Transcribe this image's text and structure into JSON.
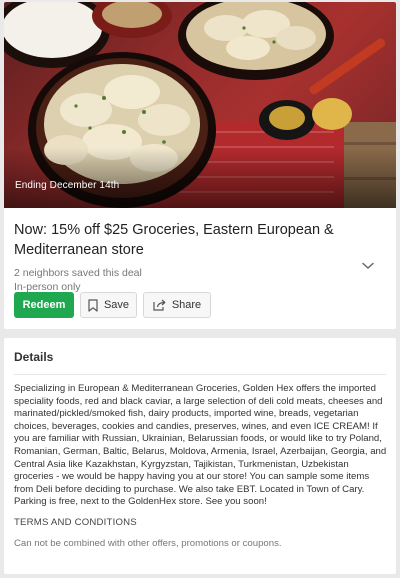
{
  "deal": {
    "ending_badge": "Ending December 14th",
    "title": "Now: 15% off $25 Groceries, Eastern European & Mediterranean store",
    "saved_count_text": "2 neighbors saved this deal",
    "availability": "In-person only",
    "actions": {
      "redeem_label": "Redeem",
      "save_label": "Save",
      "share_label": "Share"
    },
    "colors": {
      "redeem": "#1fa84f"
    }
  },
  "details": {
    "heading": "Details",
    "body": "Specializing in European & Mediterranean Groceries, Golden Hex offers the imported speciality foods, red and black caviar, a large selection of deli cold meats, cheeses and marinated/pickled/smoked fish, dairy products, imported wine, breads, vegetarian choices, beverages, cookies and candies, preserves, wines, and even ICE CREAM! If you are familiar with Russian, Ukrainian, Belarussian foods, or would like to try Poland, Romanian, German, Baltic, Belarus,  Moldova, Armenia, Israel, Azerbaijan, Georgia, and Central Asia like Kazakhstan, Kyrgyzstan, Tajikistan, Turkmenistan, Uzbekistan groceries - we would be happy having you at our store! You can sample some items from Deli before deciding to purchase. We also take EBT.  Located in Town of Cary.  Parking is free, next to the GoldenHex store. See you soon!",
    "terms_heading": "TERMS AND CONDITIONS",
    "terms_text": "Can not be combined with other offers, promotions or coupons."
  },
  "icons": {
    "save": "bookmark-icon",
    "share": "share-icon",
    "expand": "chevron-down-icon"
  }
}
